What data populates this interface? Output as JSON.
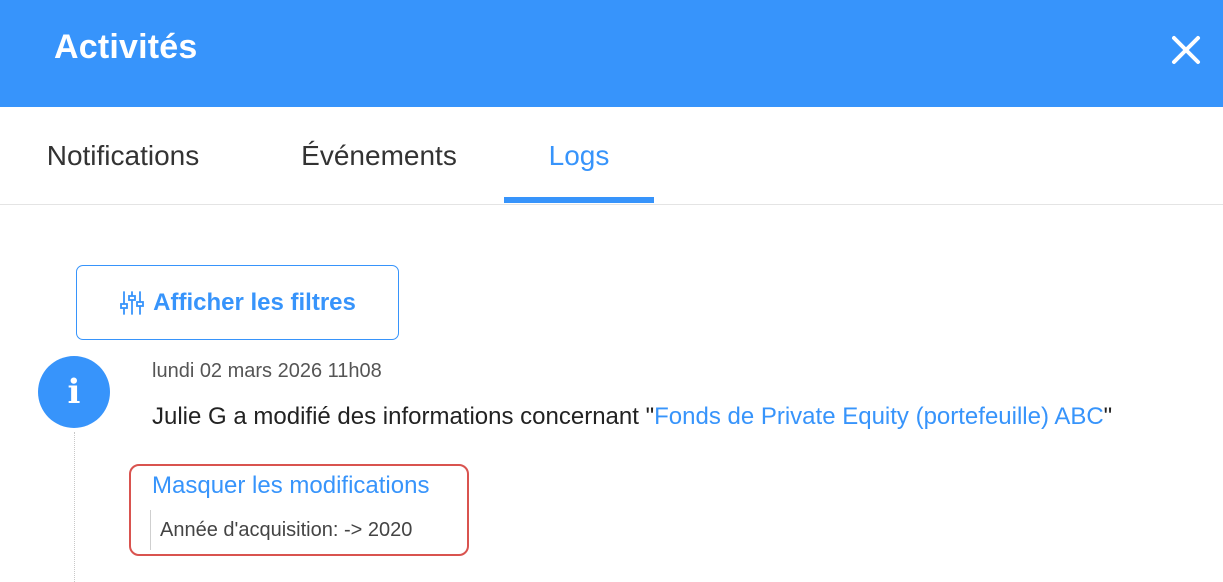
{
  "header": {
    "title": "Activités",
    "close_icon": "close-icon"
  },
  "tabs": [
    {
      "label": "Notifications",
      "active": false
    },
    {
      "label": "Événements",
      "active": false
    },
    {
      "label": "Logs",
      "active": true
    }
  ],
  "filters": {
    "label": "Afficher les filtres",
    "icon": "sliders-icon"
  },
  "log_entry": {
    "icon": "info-icon",
    "icon_glyph": "i",
    "date": "lundi 02 mars 2026 11h08",
    "text_before": "Julie G a modifié des informations concernant \"",
    "link_text": "Fonds de Private Equity (portefeuille) ABC",
    "text_after": "\"",
    "toggle_label": "Masquer les modifications",
    "changes": [
      "Année d'acquisition: -> 2020"
    ]
  },
  "colors": {
    "accent": "#3794fb",
    "highlight": "#d9534f"
  }
}
